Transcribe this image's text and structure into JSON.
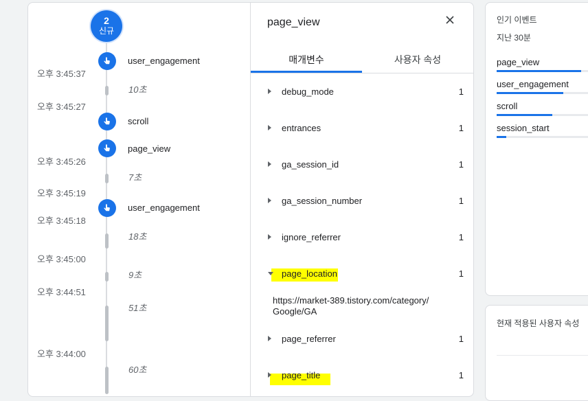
{
  "timeline": {
    "badge": {
      "count": "2",
      "label": "신규"
    },
    "events": [
      {
        "name": "user_engagement"
      },
      {
        "name": "scroll"
      },
      {
        "name": "page_view"
      },
      {
        "name": "user_engagement"
      }
    ],
    "times": [
      "오후 3:45:37",
      "오후 3:45:27",
      "오후 3:45:26",
      "오후 3:45:19",
      "오후 3:45:18",
      "오후 3:45:00",
      "오후 3:44:51",
      "오후 3:44:00"
    ],
    "durations": [
      "10초",
      "7초",
      "18초",
      "9초",
      "51초",
      "60초"
    ]
  },
  "params": {
    "title": "page_view",
    "close_icon": "close-icon",
    "tabs": [
      "매개변수",
      "사용자 속성"
    ],
    "rows": [
      {
        "name": "debug_mode",
        "count": "1"
      },
      {
        "name": "entrances",
        "count": "1"
      },
      {
        "name": "ga_session_id",
        "count": "1"
      },
      {
        "name": "ga_session_number",
        "count": "1"
      },
      {
        "name": "ignore_referrer",
        "count": "1"
      },
      {
        "name": "page_location",
        "count": "1",
        "value": "https://market-389.tistory.com/category/Google/GA"
      },
      {
        "name": "page_referrer",
        "count": "1"
      },
      {
        "name": "page_title",
        "count": "1"
      }
    ]
  },
  "top_events": {
    "title": "인기 이벤트",
    "period": "지난 30분",
    "items": [
      {
        "name": "page_view",
        "share": 0.88
      },
      {
        "name": "user_engagement",
        "share": 0.69
      },
      {
        "name": "scroll",
        "share": 0.58
      },
      {
        "name": "session_start",
        "share": 0.1
      }
    ]
  },
  "user_props": {
    "title": "현재 적용된 사용자 속성"
  },
  "colors": {
    "accent": "#1a73e8",
    "highlight": "#ffff00"
  }
}
